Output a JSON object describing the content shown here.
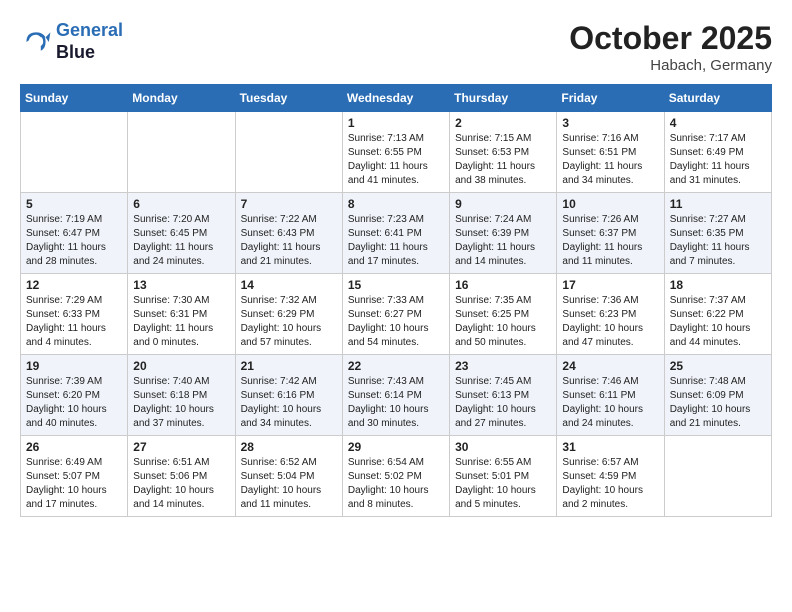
{
  "logo": {
    "line1": "General",
    "line2": "Blue"
  },
  "title": "October 2025",
  "location": "Habach, Germany",
  "days_of_week": [
    "Sunday",
    "Monday",
    "Tuesday",
    "Wednesday",
    "Thursday",
    "Friday",
    "Saturday"
  ],
  "weeks": [
    [
      {
        "day": "",
        "info": ""
      },
      {
        "day": "",
        "info": ""
      },
      {
        "day": "",
        "info": ""
      },
      {
        "day": "1",
        "info": "Sunrise: 7:13 AM\nSunset: 6:55 PM\nDaylight: 11 hours\nand 41 minutes."
      },
      {
        "day": "2",
        "info": "Sunrise: 7:15 AM\nSunset: 6:53 PM\nDaylight: 11 hours\nand 38 minutes."
      },
      {
        "day": "3",
        "info": "Sunrise: 7:16 AM\nSunset: 6:51 PM\nDaylight: 11 hours\nand 34 minutes."
      },
      {
        "day": "4",
        "info": "Sunrise: 7:17 AM\nSunset: 6:49 PM\nDaylight: 11 hours\nand 31 minutes."
      }
    ],
    [
      {
        "day": "5",
        "info": "Sunrise: 7:19 AM\nSunset: 6:47 PM\nDaylight: 11 hours\nand 28 minutes."
      },
      {
        "day": "6",
        "info": "Sunrise: 7:20 AM\nSunset: 6:45 PM\nDaylight: 11 hours\nand 24 minutes."
      },
      {
        "day": "7",
        "info": "Sunrise: 7:22 AM\nSunset: 6:43 PM\nDaylight: 11 hours\nand 21 minutes."
      },
      {
        "day": "8",
        "info": "Sunrise: 7:23 AM\nSunset: 6:41 PM\nDaylight: 11 hours\nand 17 minutes."
      },
      {
        "day": "9",
        "info": "Sunrise: 7:24 AM\nSunset: 6:39 PM\nDaylight: 11 hours\nand 14 minutes."
      },
      {
        "day": "10",
        "info": "Sunrise: 7:26 AM\nSunset: 6:37 PM\nDaylight: 11 hours\nand 11 minutes."
      },
      {
        "day": "11",
        "info": "Sunrise: 7:27 AM\nSunset: 6:35 PM\nDaylight: 11 hours\nand 7 minutes."
      }
    ],
    [
      {
        "day": "12",
        "info": "Sunrise: 7:29 AM\nSunset: 6:33 PM\nDaylight: 11 hours\nand 4 minutes."
      },
      {
        "day": "13",
        "info": "Sunrise: 7:30 AM\nSunset: 6:31 PM\nDaylight: 11 hours\nand 0 minutes."
      },
      {
        "day": "14",
        "info": "Sunrise: 7:32 AM\nSunset: 6:29 PM\nDaylight: 10 hours\nand 57 minutes."
      },
      {
        "day": "15",
        "info": "Sunrise: 7:33 AM\nSunset: 6:27 PM\nDaylight: 10 hours\nand 54 minutes."
      },
      {
        "day": "16",
        "info": "Sunrise: 7:35 AM\nSunset: 6:25 PM\nDaylight: 10 hours\nand 50 minutes."
      },
      {
        "day": "17",
        "info": "Sunrise: 7:36 AM\nSunset: 6:23 PM\nDaylight: 10 hours\nand 47 minutes."
      },
      {
        "day": "18",
        "info": "Sunrise: 7:37 AM\nSunset: 6:22 PM\nDaylight: 10 hours\nand 44 minutes."
      }
    ],
    [
      {
        "day": "19",
        "info": "Sunrise: 7:39 AM\nSunset: 6:20 PM\nDaylight: 10 hours\nand 40 minutes."
      },
      {
        "day": "20",
        "info": "Sunrise: 7:40 AM\nSunset: 6:18 PM\nDaylight: 10 hours\nand 37 minutes."
      },
      {
        "day": "21",
        "info": "Sunrise: 7:42 AM\nSunset: 6:16 PM\nDaylight: 10 hours\nand 34 minutes."
      },
      {
        "day": "22",
        "info": "Sunrise: 7:43 AM\nSunset: 6:14 PM\nDaylight: 10 hours\nand 30 minutes."
      },
      {
        "day": "23",
        "info": "Sunrise: 7:45 AM\nSunset: 6:13 PM\nDaylight: 10 hours\nand 27 minutes."
      },
      {
        "day": "24",
        "info": "Sunrise: 7:46 AM\nSunset: 6:11 PM\nDaylight: 10 hours\nand 24 minutes."
      },
      {
        "day": "25",
        "info": "Sunrise: 7:48 AM\nSunset: 6:09 PM\nDaylight: 10 hours\nand 21 minutes."
      }
    ],
    [
      {
        "day": "26",
        "info": "Sunrise: 6:49 AM\nSunset: 5:07 PM\nDaylight: 10 hours\nand 17 minutes."
      },
      {
        "day": "27",
        "info": "Sunrise: 6:51 AM\nSunset: 5:06 PM\nDaylight: 10 hours\nand 14 minutes."
      },
      {
        "day": "28",
        "info": "Sunrise: 6:52 AM\nSunset: 5:04 PM\nDaylight: 10 hours\nand 11 minutes."
      },
      {
        "day": "29",
        "info": "Sunrise: 6:54 AM\nSunset: 5:02 PM\nDaylight: 10 hours\nand 8 minutes."
      },
      {
        "day": "30",
        "info": "Sunrise: 6:55 AM\nSunset: 5:01 PM\nDaylight: 10 hours\nand 5 minutes."
      },
      {
        "day": "31",
        "info": "Sunrise: 6:57 AM\nSunset: 4:59 PM\nDaylight: 10 hours\nand 2 minutes."
      },
      {
        "day": "",
        "info": ""
      }
    ]
  ]
}
